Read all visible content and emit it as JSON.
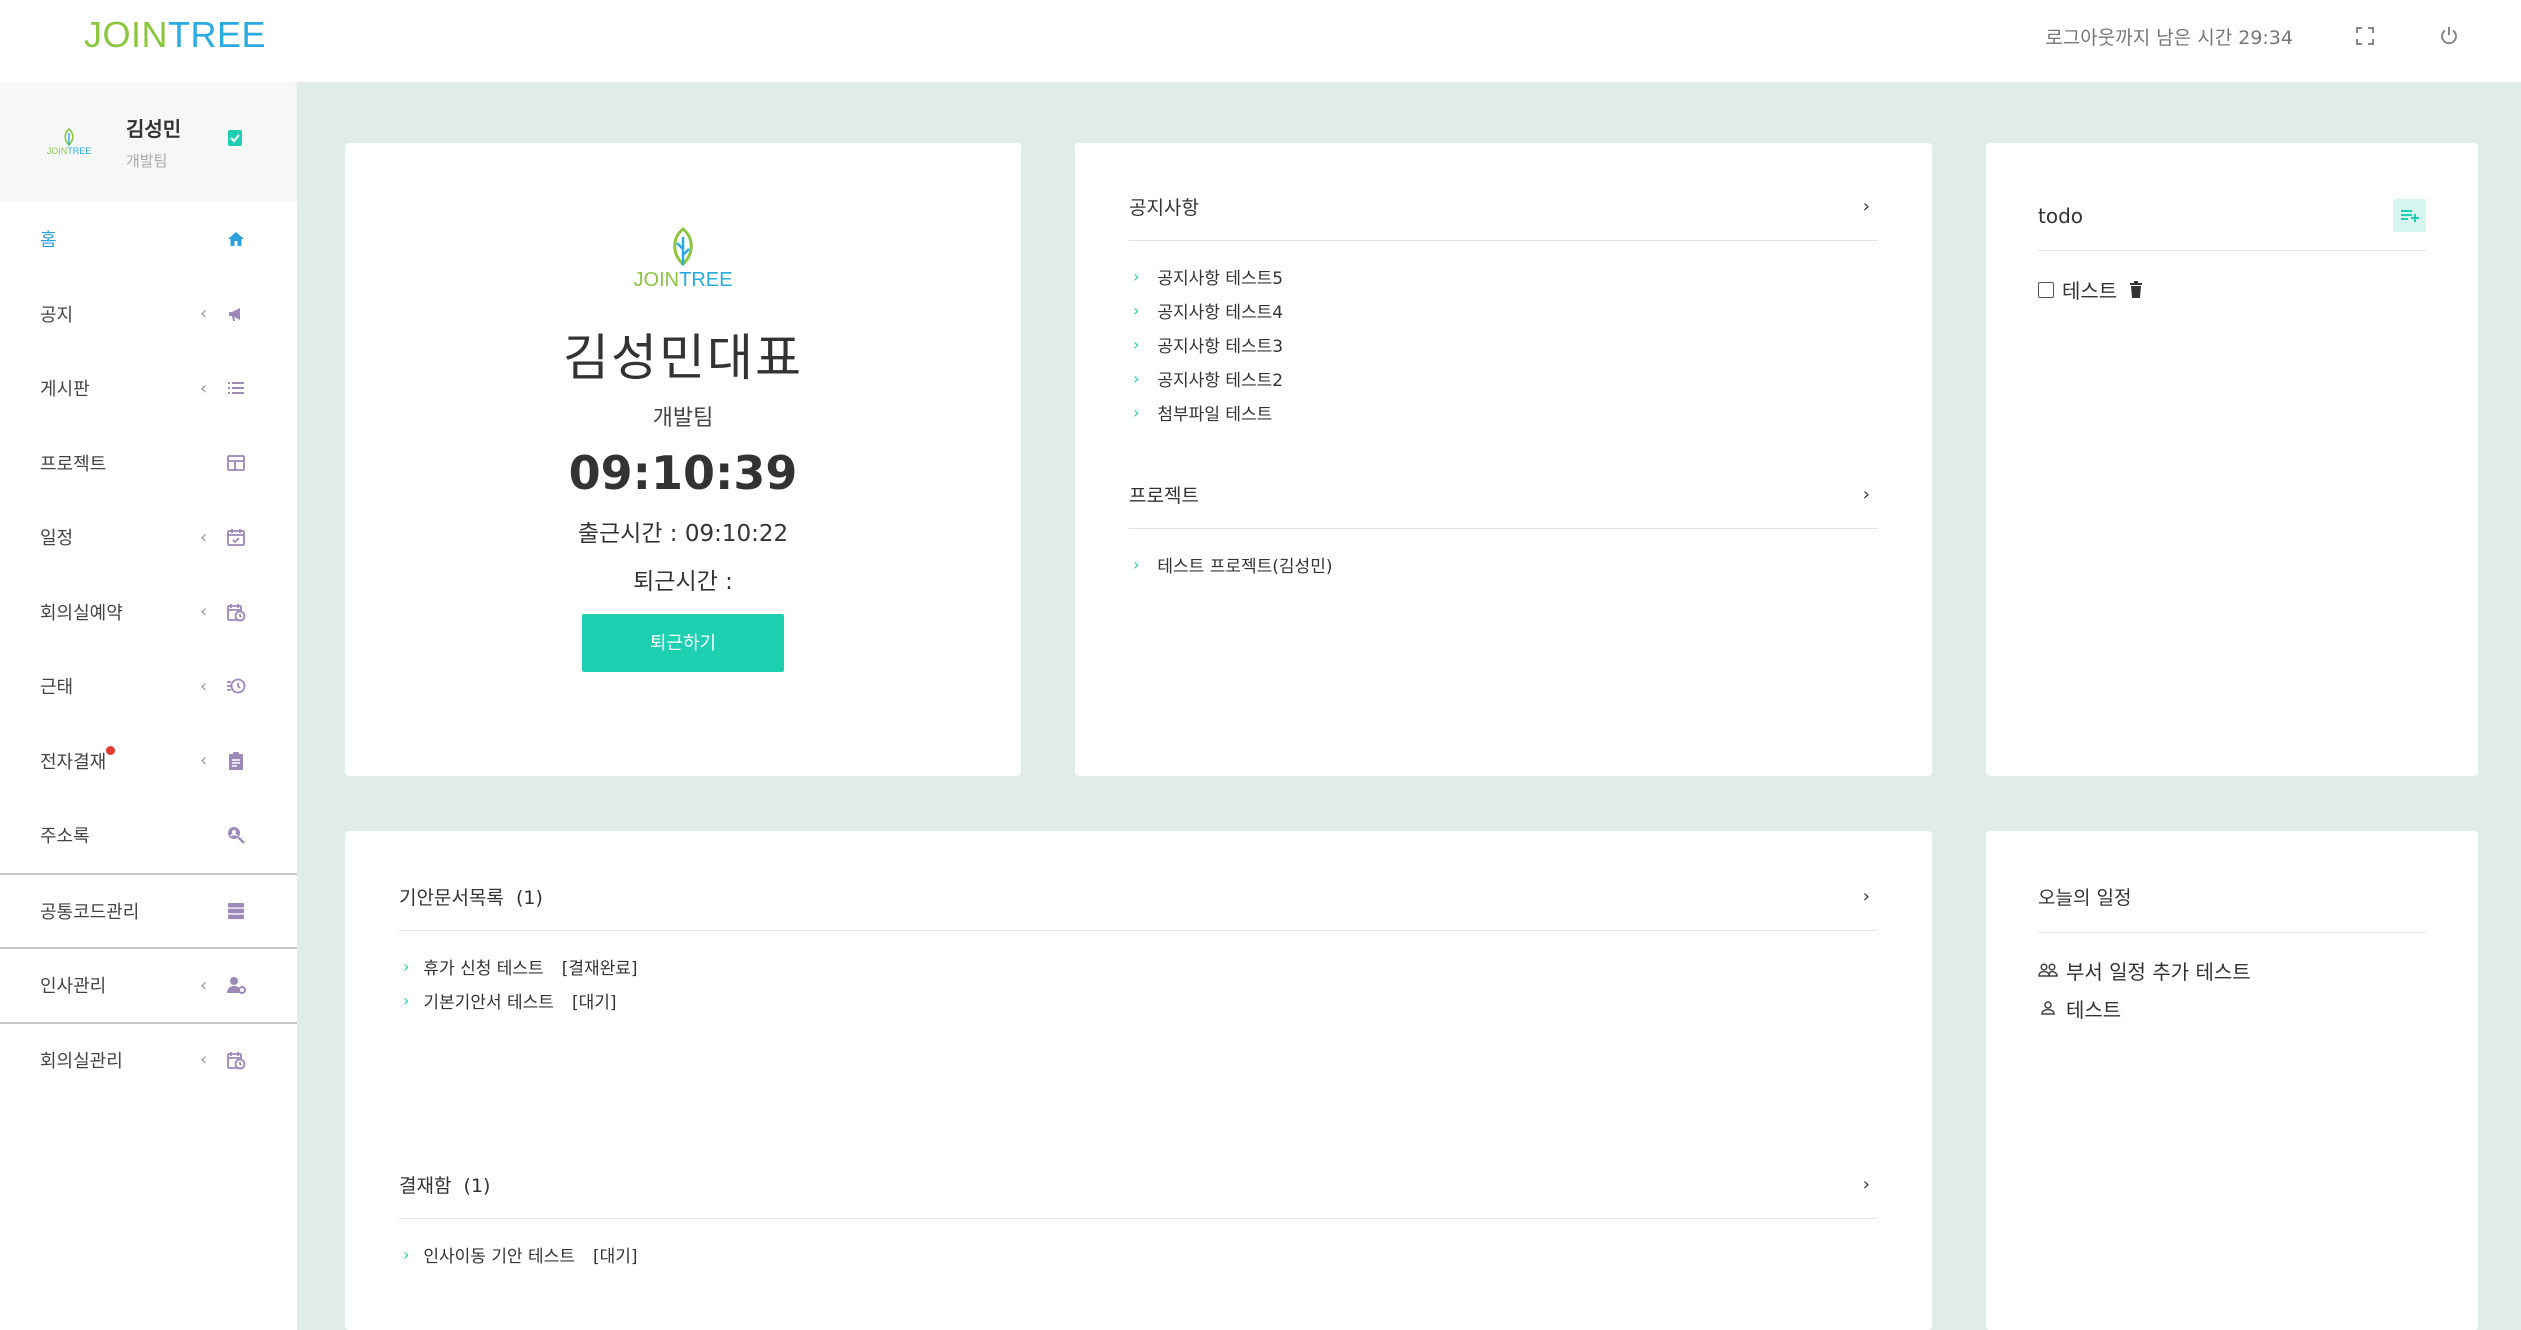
{
  "header": {
    "brand_join": "JOIN",
    "brand_tree": "TREE",
    "logout_timer": "로그아웃까지 남은 시간 29:34",
    "icons": [
      "fullscreen-icon",
      "power-icon"
    ]
  },
  "sidebar": {
    "profile": {
      "logo_join": "JOIN",
      "logo_tree": "TREE",
      "name": "김성민",
      "dept": "개발팀"
    },
    "items": [
      {
        "label": "홈",
        "icon": "home-icon",
        "expand": false,
        "active": true
      },
      {
        "label": "공지",
        "icon": "megaphone-icon",
        "expand": true
      },
      {
        "label": "게시판",
        "icon": "list-icon",
        "expand": true
      },
      {
        "label": "프로젝트",
        "icon": "table-icon",
        "expand": false
      },
      {
        "label": "일정",
        "icon": "calendar-check-icon",
        "expand": true
      },
      {
        "label": "회의실예약",
        "icon": "calendar-clock-icon",
        "expand": true
      },
      {
        "label": "근태",
        "icon": "history-icon",
        "expand": true
      },
      {
        "label": "전자결재",
        "icon": "clipboard-icon",
        "expand": true,
        "notify": true
      },
      {
        "label": "주소록",
        "icon": "search-person-icon",
        "expand": false
      },
      {
        "label": "공통코드관리",
        "icon": "server-icon",
        "expand": false
      },
      {
        "label": "인사관리",
        "icon": "user-gear-icon",
        "expand": true
      },
      {
        "label": "회의실관리",
        "icon": "calendar-clock-icon",
        "expand": true
      }
    ]
  },
  "profile_card": {
    "logo_join": "JOIN",
    "logo_tree": "TREE",
    "name_title": "김성민대표",
    "dept": "개발팀",
    "clock": "09:10:39",
    "check_in": "출근시간 : 09:10:22",
    "check_out": "퇴근시간 :",
    "button": "퇴근하기"
  },
  "notice_card": {
    "notice_title": "공지사항",
    "notices": [
      "공지사항 테스트5",
      "공지사항 테스트4",
      "공지사항 테스트3",
      "공지사항 테스트2",
      "첨부파일 테스트"
    ],
    "project_title": "프로젝트",
    "projects": [
      "테스트 프로젝트(김성민)"
    ]
  },
  "todo_card": {
    "title": "todo",
    "items": [
      {
        "label": "테스트",
        "checked": false
      }
    ]
  },
  "docs_card": {
    "draft_title": "기안문서목록",
    "draft_count": "(1)",
    "drafts": [
      {
        "title": "휴가 신청 테스트",
        "status": "[결재완료]"
      },
      {
        "title": "기본기안서 테스트",
        "status": "[대기]"
      }
    ],
    "approve_title": "결재함",
    "approve_count": "(1)",
    "approvals": [
      {
        "title": "인사이동 기안 테스트",
        "status": "[대기]"
      }
    ]
  },
  "today_card": {
    "title": "오늘의 일정",
    "items": [
      {
        "label": "부서 일정 추가 테스트",
        "icon": "group-icon"
      },
      {
        "label": "테스트",
        "icon": "person-icon"
      }
    ]
  },
  "colors": {
    "accent": "#1fcfb1",
    "brand_green": "#8cc63f",
    "brand_blue": "#29abe2",
    "icon_purple": "#9c89b8",
    "active_blue": "#2d9fd9",
    "background": "#dfece8"
  }
}
